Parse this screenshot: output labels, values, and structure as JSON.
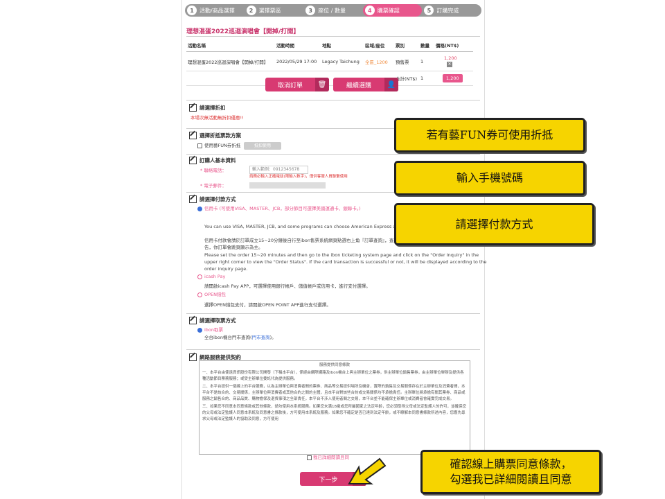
{
  "steps": [
    {
      "num": "1",
      "label": "活動/商品選擇"
    },
    {
      "num": "2",
      "label": "選擇票區"
    },
    {
      "num": "3",
      "label": "座位 / 數量"
    },
    {
      "num": "4",
      "label": "購票確認"
    },
    {
      "num": "5",
      "label": "訂購完成"
    }
  ],
  "event_title": "理想混蛋2022巡迴演唱會【開掉/打開】",
  "table": {
    "headers": [
      "活動名稱",
      "活動時間",
      "地點",
      "區域/座位",
      "票別",
      "數量",
      "價格(NT$)"
    ],
    "row": {
      "name": "理想混蛋2022巡迴演唱會【開掉/打開】",
      "time": "2022/05/29 17:00",
      "venue": "Legacy Taichung",
      "area": "全區_1200",
      "type": "預售票",
      "qty": "1",
      "price": "1,200"
    },
    "total_label": "合計(NT$)",
    "total_qty": "1",
    "total_price": "1,200"
  },
  "buttons": {
    "cancel": "取消訂單",
    "continue": "繼續選購",
    "next": "下一步",
    "fun_apply": "抵扣使用"
  },
  "sections": {
    "discount": "請選擇折扣",
    "discount_note": "本場次無活動無折扣優惠!!",
    "fun": "選擇折抵票款方案",
    "fun_option": "使用藝FUN券折抵",
    "basic": "訂購人基本資料",
    "phone_label": "* 聯絡電話：",
    "phone_placeholder": "輸入範例：0912345678",
    "phone_hint": "請務必輸入正確電話(限輸入數字)，僅供客服人員聯繫使用",
    "email_label": "* 電子郵件：",
    "payment": "請選擇付款方式",
    "pay_cc": "信用卡 (可使用VISA、MASTER、JCB，部分節目可選擇美國運通卡、銀聯卡。)",
    "pay_cc_en1": "You can use VISA, MASTER, JCB, and some programs can choose American Express and U",
    "pay_cc_zh": "信用卡付款會請於訂單成立15~20分鐘後自行至ibon售票系統網頁點選右上角『訂單查詢』，查詢訂單狀態，若信用卡交易成功或失敗，皆會",
    "pay_cc_zh2": "告，你訂單會跳頁顯示為主。",
    "pay_cc_en2": "Please set the order 15~20 minutes and then go to the ibon ticketing system page and click on the \"Order Inquiry\" in the",
    "pay_cc_en3": "upper right corner to view the \"Order Status\". If the card transaction is successful or not, it will be displayed according to the",
    "pay_cc_en4": "order inquiry page.",
    "pay_icash": "icash Pay",
    "pay_icash_desc": "請開啟icash Pay APP，可選擇使用銀行帳戶、儲值帳戶或信用卡，進行支付選擇。",
    "pay_open": "OPEN錢包",
    "pay_open_desc": "選擇OPEN錢包支付，請開啟OPEN POINT APP進行支付選擇。",
    "pickup": "請選擇取票方式",
    "pickup_opt": "ibon取票",
    "pickup_desc": "全台ibon機台門市查詢(",
    "pickup_link": "門市查詢",
    "pickup_end": ")。",
    "contract": "網路服務提供契約",
    "contract_title": "服務提供同意條款",
    "agree": "我已詳細閱讀且同"
  },
  "contract_paras": [
    "一、本平台由使遠資訊股份有限公司開發（下稱本平台），係經由網際網路及ibon機台上與主辦單位之票券，供主辦單位銷售票券，由主辦單位舉辦及提供各種活動節目票務服務；或受主辦單位委託代為提供服務。",
    "二、本平台提供一個線上的平台服務，以為主辦單位與消費者間的票券、商品等交易提供場所及機會，實際的銷售及交易關係存在於主辦單位及消費者間，本平台不是該合約、交易關係，主辦單位與消費者或其他合約之間的主體，且本平台對該些合約或交易關係均不承擔責任。主辦單位將承擔有關其票券、商品或服務之銷售合約、商品品質、購物擔保及退貨事項之全部責任，本平台不涉入使用者間之交易，本平台並不能確保主辦單位或消費者會確實完成交易。",
    "三、如果您不同意本同意條款或其他條款，請勿使用本系統服務。如果您未滿18歲或您所屬國家之法定年齡，您必須取得父母或法定監護人的許可，並確保您的父母或法定監護人同意本系統及同意書之條款後，方可使用本系統及服務。如果您不確定是否已達到法定年齡，或不瞭解本同意書條款所述內容，您應先尋求父母或法定監護人的協助及同意，方可使用"
  ],
  "callouts": {
    "fun": "若有藝FUN券可使用折抵",
    "phone": "輸入手機號碼",
    "pay": "請選擇付款方式",
    "agree_l1": "確認線上購票同意條款，",
    "agree_l2": "勾選我已詳細閱讀且同意"
  },
  "colors": {
    "accent": "#e8568c",
    "button": "#d83a72",
    "callout": "#f6d400"
  }
}
